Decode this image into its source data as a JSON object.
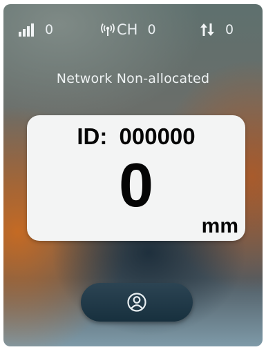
{
  "status_bar": {
    "signal": {
      "icon": "signal-bars-icon",
      "value": "0"
    },
    "channel": {
      "icon": "antenna-icon",
      "label": "CH",
      "value": "0"
    },
    "traffic": {
      "icon": "up-down-arrows-icon",
      "value": "0"
    }
  },
  "network_status": "Network Non-allocated",
  "reading_card": {
    "id_label": "ID:",
    "id_value": "000000",
    "value": "0",
    "unit": "mm"
  },
  "user_button": {
    "icon": "user-icon"
  },
  "colors": {
    "card_background": "#f3f4f4",
    "button_background": "#1f3a48",
    "status_text": "#e9eef0"
  }
}
